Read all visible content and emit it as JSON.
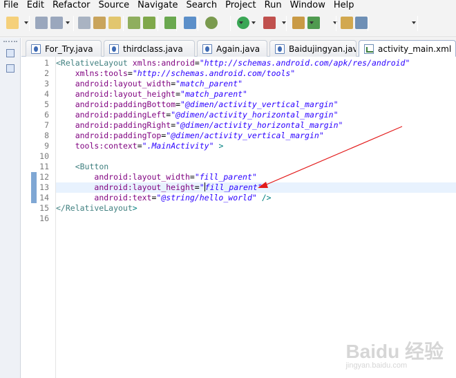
{
  "menu": [
    "File",
    "Edit",
    "Refactor",
    "Source",
    "Navigate",
    "Search",
    "Project",
    "Run",
    "Window",
    "Help"
  ],
  "toolbar_icons": [
    "new-wizard-icon",
    "save-icon",
    "save-all-icon",
    "print-icon",
    "open-type-icon",
    "open-task-icon",
    "next-annotation-icon",
    "android-sdk-icon",
    "checklist-icon",
    "android-lint-icon",
    "debug-icon",
    "run-icon",
    "external-tools-icon",
    "new-package-icon",
    "new-class-icon",
    "open-perspective-icon",
    "search-icon"
  ],
  "tabs": [
    {
      "label": "For_Try.java",
      "icon": "java-file-icon",
      "active": false
    },
    {
      "label": "thirdclass.java",
      "icon": "java-file-icon",
      "active": false
    },
    {
      "label": "Again.java",
      "icon": "java-file-icon",
      "active": false
    },
    {
      "label": "Baidujingyan.java",
      "icon": "java-file-icon",
      "active": false
    },
    {
      "label": "activity_main.xml",
      "icon": "xml-file-icon",
      "active": true
    }
  ],
  "editor": {
    "current_line": 13,
    "lines": [
      "<RelativeLayout xmlns:android=\"http://schemas.android.com/apk/res/android\"",
      "    xmlns:tools=\"http://schemas.android.com/tools\"",
      "    android:layout_width=\"match_parent\"",
      "    android:layout_height=\"match_parent\"",
      "    android:paddingBottom=\"@dimen/activity_vertical_margin\"",
      "    android:paddingLeft=\"@dimen/activity_horizontal_margin\"",
      "    android:paddingRight=\"@dimen/activity_horizontal_margin\"",
      "    android:paddingTop=\"@dimen/activity_vertical_margin\"",
      "    tools:context=\".MainActivity\" >",
      "",
      "    <Button",
      "        android:layout_width=\"fill_parent\"",
      "        android:layout_height=\"fill_parent\"",
      "        android:text=\"@string/hello_world\" />",
      "</RelativeLayout>",
      ""
    ]
  },
  "colors": {
    "tag": "#3f7f7f",
    "attribute": "#7f007f",
    "value": "#2a00ff",
    "current_line": "#e8f2fe",
    "annotation_arrow": "#e31b1b"
  },
  "watermark": {
    "brand": "Baidu 经验",
    "url": "jingyan.baidu.com"
  }
}
